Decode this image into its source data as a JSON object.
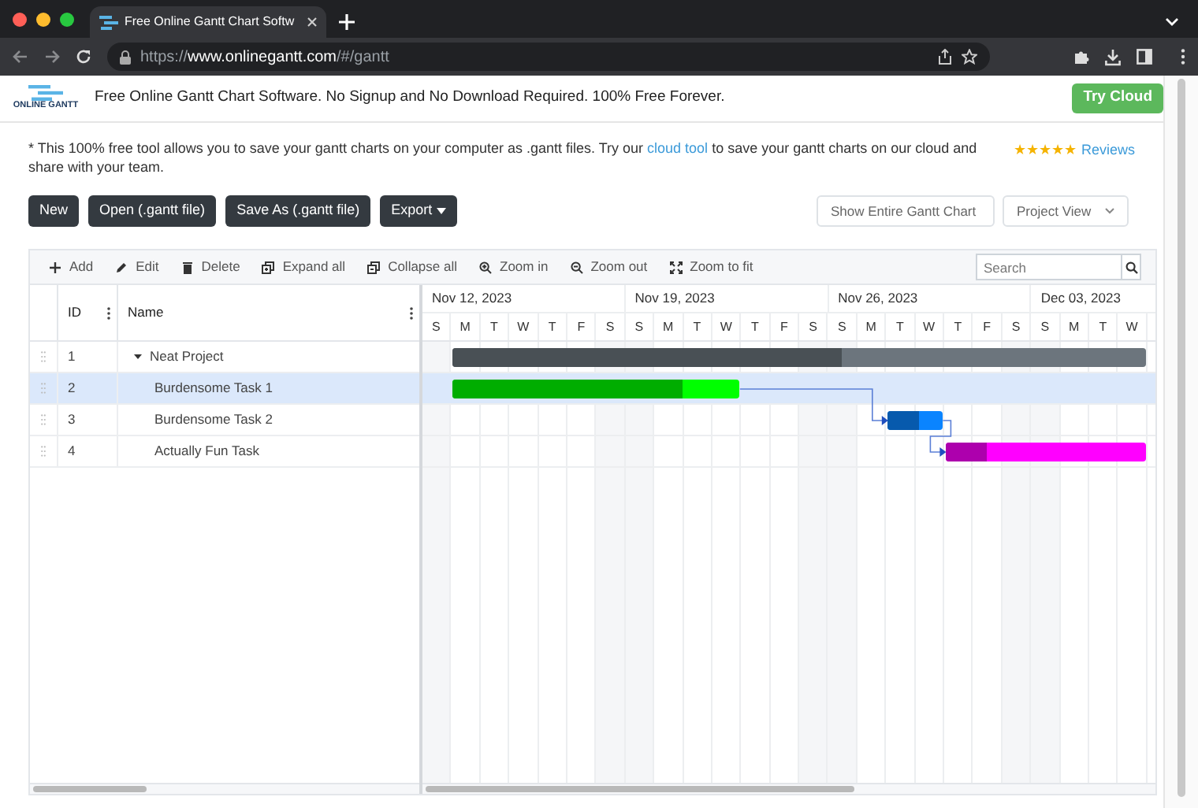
{
  "browser": {
    "tab_title": "Free Online Gantt Chart Softw",
    "url_prefix": "https://",
    "url_host": "www.onlinegantt.com",
    "url_path": "/#/gantt"
  },
  "header": {
    "logo_text": "ONLINE GANTT",
    "tagline": "Free Online Gantt Chart Software. No Signup and No Download Required. 100% Free Forever.",
    "cta": "Try Cloud"
  },
  "notice": {
    "text": "* This 100% free tool allows you to save your gantt charts on your computer as .gantt files. Try our",
    "link": "cloud tool",
    "rest": "to save your gantt charts on our cloud and share with your team.",
    "stars": 5,
    "reviews": "Reviews"
  },
  "buttons": [
    {
      "label": "New",
      "kind": "plain"
    },
    {
      "label": "Open (.gantt file)",
      "kind": "plain"
    },
    {
      "label": "Save As (.gantt file)",
      "kind": "plain"
    },
    {
      "label": "Export",
      "kind": "dropdown"
    }
  ],
  "selects": [
    "Show Entire Gantt Chart",
    "Project View"
  ],
  "toolbar": [
    {
      "label": "Add",
      "kind": "add"
    },
    {
      "label": "Edit",
      "kind": "edit"
    },
    {
      "label": "Delete",
      "kind": "delete"
    },
    {
      "label": "Expand all",
      "kind": "expand"
    },
    {
      "label": "Collapse all",
      "kind": "collapse"
    },
    {
      "label": "Zoom in",
      "kind": "zoomin"
    },
    {
      "label": "Zoom out",
      "kind": "zoomout"
    },
    {
      "label": "Zoom to fit",
      "kind": "fit"
    }
  ],
  "search": {
    "placeholder": "Search"
  },
  "columns": [
    "ID",
    "Name"
  ],
  "timeline": {
    "weeks": [
      "Nov 12, 2023",
      "Nov 19, 2023",
      "Nov 26, 2023",
      "Dec 03, 2023"
    ],
    "days": [
      "S",
      "M",
      "T",
      "W",
      "T",
      "F",
      "S",
      "S",
      "M",
      "T",
      "W",
      "T",
      "F",
      "S",
      "S",
      "M",
      "T",
      "W",
      "T",
      "F",
      "S",
      "S",
      "M",
      "T",
      "W"
    ]
  },
  "tasks": [
    {
      "id": "1",
      "name": "Neat Project",
      "kind": "project",
      "expanded": true,
      "selected": false,
      "level": 0.56,
      "color": "#6c757d",
      "links_to_next": false
    },
    {
      "id": "2",
      "name": "Burdensome Task 1",
      "kind": "task",
      "selected": true,
      "level": 0.8,
      "color": "#00ff00",
      "links_to_next": true
    },
    {
      "id": "3",
      "name": "Burdensome Task 2",
      "kind": "task",
      "selected": false,
      "level": 0.55,
      "color": "#0a84ff",
      "links_to_next": true
    },
    {
      "id": "4",
      "name": "Actually Fun Task",
      "kind": "task",
      "selected": false,
      "level": 0.2,
      "color": "#ff00ff",
      "links_to_next": false
    }
  ]
}
